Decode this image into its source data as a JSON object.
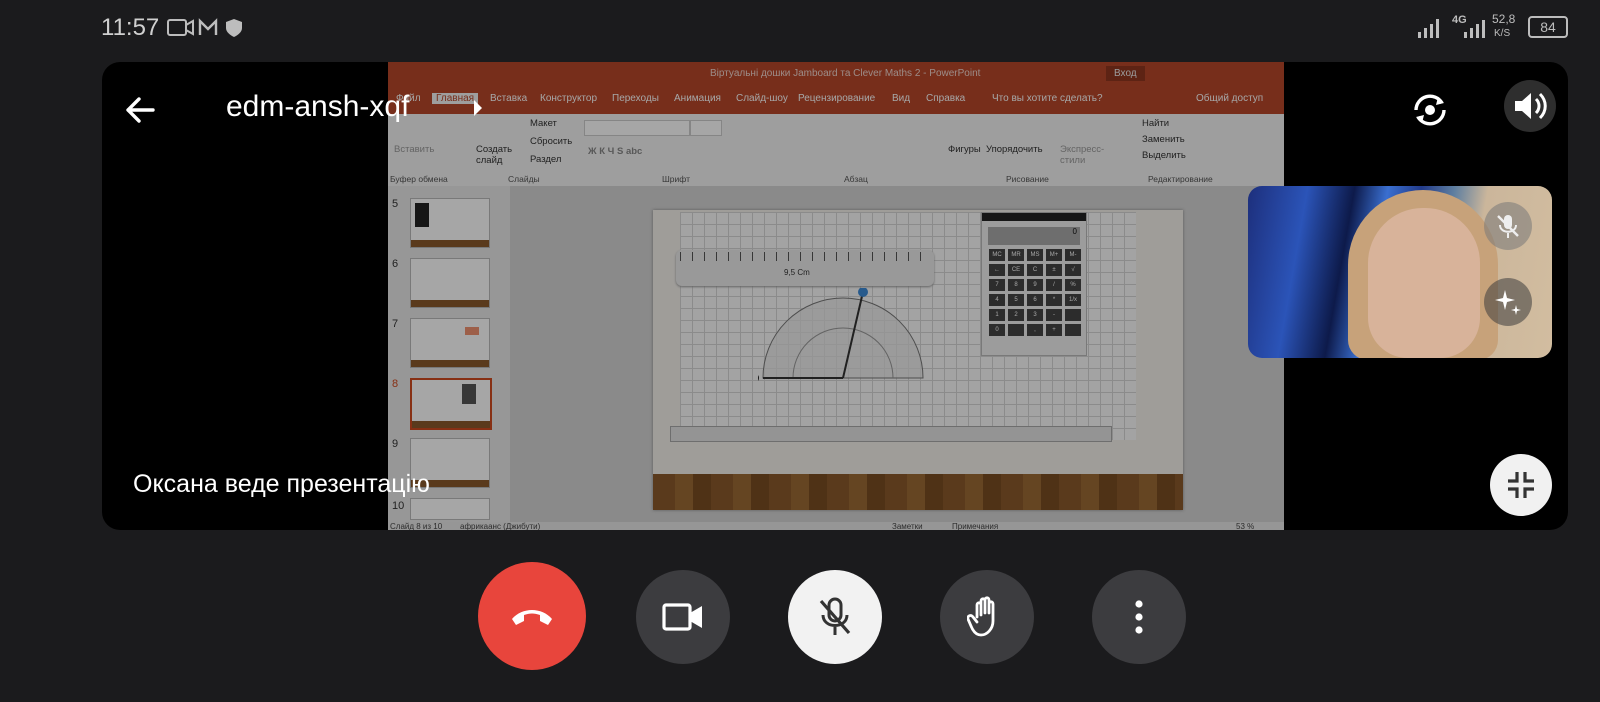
{
  "status_bar": {
    "time": "11:57",
    "network": "4G",
    "speed": "52,8",
    "speed_unit": "K/S",
    "battery": "84"
  },
  "meeting": {
    "code": "edm-ansh-xqf",
    "presenter_label": "Оксана веде презентацію"
  },
  "powerpoint": {
    "window_title": "Віртуальні дошки Jamboard та Clever Maths 2  -  PowerPoint",
    "login": "Вход",
    "tabs": [
      "Файл",
      "Главная",
      "Вставка",
      "Конструктор",
      "Переходы",
      "Анимация",
      "Слайд-шоу",
      "Рецензирование",
      "Вид",
      "Справка",
      "Что вы хотите сделать?",
      "Общий доступ"
    ],
    "ribbon": {
      "paste": "Вставить",
      "create_slide": "Создать слайд",
      "layout": "Макет",
      "reset": "Сбросить",
      "section": "Раздел",
      "shapes": "Фигуры",
      "arrange": "Упорядочить",
      "quick_styles": "Экспресс-стили",
      "find": "Найти",
      "replace": "Заменить",
      "select": "Выделить",
      "groups": [
        "Буфер обмена",
        "Слайды",
        "Шрифт",
        "Абзац",
        "Рисование",
        "Редактирование"
      ]
    },
    "slide_numbers": [
      "5",
      "6",
      "7",
      "8",
      "9",
      "10"
    ],
    "selected_slide": "8",
    "ruler_readout": "9,5 Cm",
    "status": {
      "slide_info": "Слайд 8 из 10",
      "language": "африкаанс (Джибути)",
      "notes": "Заметки",
      "comments": "Примечания",
      "zoom": "53 %"
    },
    "calculator_keys": [
      "MC",
      "MR",
      "MS",
      "M+",
      "M-",
      "←",
      "CE",
      "C",
      "±",
      "√",
      "7",
      "8",
      "9",
      "/",
      "%",
      "4",
      "5",
      "6",
      "*",
      "1/x",
      "1",
      "2",
      "3",
      "-",
      "",
      "0",
      "",
      ",",
      "+",
      ""
    ],
    "calculator_display": "0"
  },
  "controls": {
    "end_call": "end-call",
    "camera": "camera",
    "mic": "mic-off",
    "hand": "raise-hand",
    "more": "more"
  },
  "colors": {
    "end_call": "#e8453c",
    "ppt_accent": "#b7472a",
    "button_grey": "#3c3c3f"
  }
}
